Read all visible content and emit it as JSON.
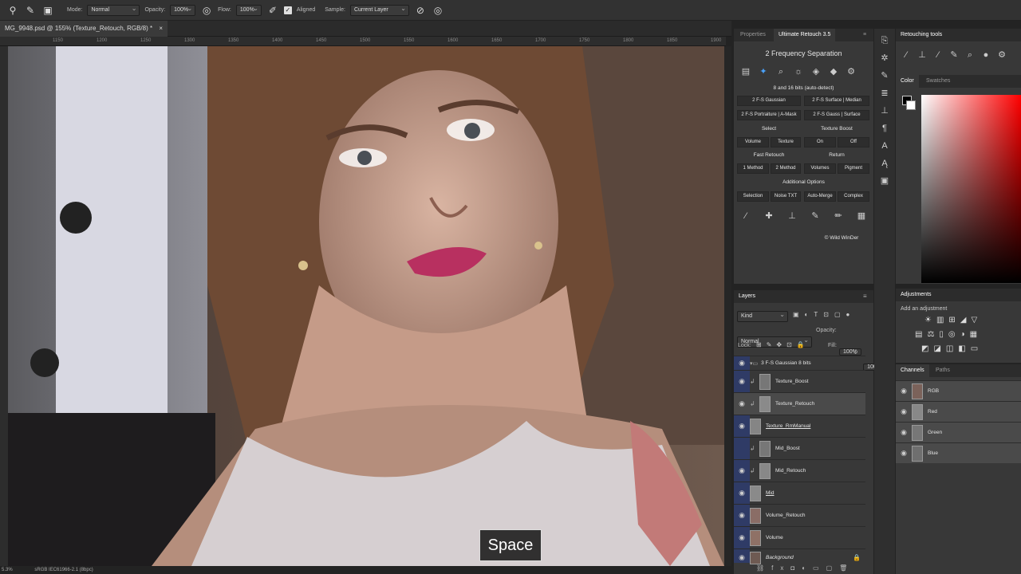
{
  "options_bar": {
    "mode_label": "Mode:",
    "mode_value": "Normal",
    "opacity_label": "Opacity:",
    "opacity_value": "100%",
    "flow_label": "Flow:",
    "flow_value": "100%",
    "aligned_label": "Aligned",
    "sample_label": "Sample:",
    "sample_value": "Current Layer"
  },
  "document": {
    "tab_title": "MG_9948.psd @ 155% (Texture_Retouch, RGB/8) *",
    "ruler_ticks": [
      "1150",
      "1200",
      "1250",
      "1300",
      "1350",
      "1400",
      "1450",
      "1500",
      "1550",
      "1600",
      "1650",
      "1700",
      "1750",
      "1800",
      "1850",
      "1900",
      "1950"
    ],
    "status_zoom": "5.3%",
    "status_profile": "sRGB IEC61966-2.1 (8bpc)",
    "key_overlay": "Space"
  },
  "panel_tabs": {
    "properties": "Properties",
    "ultimate_retouch": "Ultimate Retouch 3.5"
  },
  "ultimate_retouch": {
    "title": "2 Frequency Separation",
    "bits_note": "8 and 16 bits (auto-detect)",
    "buttons_row1": [
      "2 F-S Gaussian",
      "2 F-S Surface | Median"
    ],
    "buttons_row2": [
      "2 F-S Portraiture | A-Mask",
      "2 F-S Gauss | Surface"
    ],
    "select_label": "Select",
    "texture_boost_label": "Texture Boost",
    "buttons_row3": [
      "Volume",
      "Texture",
      "On",
      "Off"
    ],
    "fast_retouch_label": "Fast Retouch",
    "return_label": "Return",
    "buttons_row4": [
      "1 Method",
      "2 Method",
      "Volumes",
      "Pigment"
    ],
    "additional_label": "Additional Options",
    "buttons_row5": [
      "Selection",
      "Noise TXT",
      "Auto-Merge",
      "Complex"
    ],
    "copyright": "© Wild WinDer"
  },
  "layers": {
    "title": "Layers",
    "kind_value": "Kind",
    "blend_value": "Normal",
    "opacity_label": "Opacity:",
    "opacity_value": "100%",
    "lock_label": "Lock:",
    "fill_label": "Fill:",
    "fill_value": "100%",
    "group_name": "3 F-S Gaussian 8 bits",
    "items": [
      {
        "name": "Texture_Boost"
      },
      {
        "name": "Texture_Retouch"
      },
      {
        "name": "Texture_RmManual"
      },
      {
        "name": "Mid_Boost"
      },
      {
        "name": "Mid_Retouch"
      },
      {
        "name": "Mid"
      },
      {
        "name": "Volume_Retouch"
      },
      {
        "name": "Volume"
      },
      {
        "name": "Background"
      }
    ]
  },
  "retouching_tools": {
    "title": "Retouching tools"
  },
  "color_panel": {
    "tab_color": "Color",
    "tab_swatches": "Swatches",
    "accent": "#ff0000"
  },
  "adjustments": {
    "title": "Adjustments",
    "subtitle": "Add an adjustment"
  },
  "channels": {
    "tab_channels": "Channels",
    "tab_paths": "Paths",
    "items": [
      {
        "name": "RGB"
      },
      {
        "name": "Red"
      },
      {
        "name": "Green"
      },
      {
        "name": "Blue"
      }
    ]
  }
}
